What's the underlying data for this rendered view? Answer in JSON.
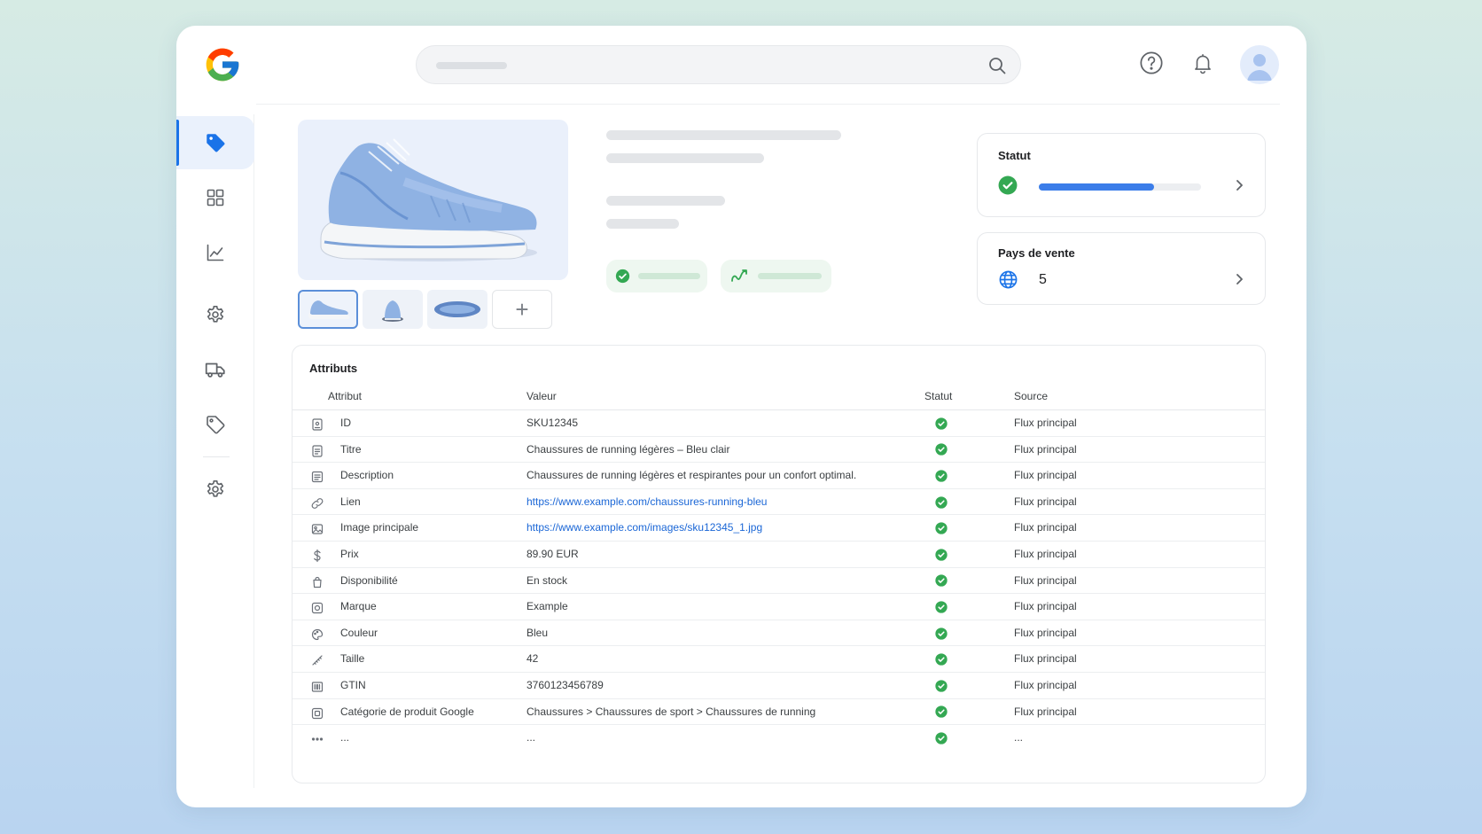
{
  "colors": {
    "accent": "#1a73e8",
    "success": "#34a853",
    "link": "#1a66d6"
  },
  "header": {
    "logo": "google-logo",
    "search": {
      "placeholder": ""
    },
    "icons": [
      "help-icon",
      "bell-icon",
      "account-icon"
    ]
  },
  "sidebar": {
    "items": [
      {
        "icon": "tag-icon",
        "active": true
      },
      {
        "icon": "grid-icon",
        "active": false
      },
      {
        "icon": "chart-icon",
        "active": false
      },
      {
        "icon": "gear-icon",
        "active": false
      },
      {
        "icon": "truck-icon",
        "active": false
      },
      {
        "icon": "tag-outline-icon",
        "active": false
      },
      {
        "icon": "gear-icon",
        "active": false
      }
    ]
  },
  "product": {
    "image": "running-shoe-light-blue",
    "thumbnails": [
      "shoe-side-view",
      "shoe-front-view",
      "shoe-sole-view"
    ],
    "add_label": "+"
  },
  "status_card": {
    "title": "Statut",
    "progress": 0.71,
    "icon": "check-circle-icon"
  },
  "countries_card": {
    "title": "Pays de vente",
    "count": "5",
    "icon": "globe-icon"
  },
  "attributes": {
    "title": "Attributs",
    "columns": {
      "attribute": "Attribut",
      "value": "Valeur",
      "status": "Statut",
      "source": "Source"
    },
    "rows": [
      {
        "icon": "id-icon",
        "attribute": "ID",
        "value": "SKU12345",
        "link": false,
        "status": "ok",
        "source": "Flux principal"
      },
      {
        "icon": "doc-icon",
        "attribute": "Titre",
        "value": "Chaussures de running légères – Bleu clair",
        "link": false,
        "status": "ok",
        "source": "Flux principal"
      },
      {
        "icon": "lines-icon",
        "attribute": "Description",
        "value": "Chaussures de running légères et respirantes pour un confort optimal.",
        "link": false,
        "status": "ok",
        "source": "Flux principal"
      },
      {
        "icon": "link-icon",
        "attribute": "Lien",
        "value": "https://www.example.com/chaussures-running-bleu",
        "link": true,
        "status": "ok",
        "source": "Flux principal"
      },
      {
        "icon": "image-icon",
        "attribute": "Image principale",
        "value": "https://www.example.com/images/sku12345_1.jpg",
        "link": true,
        "status": "ok",
        "source": "Flux principal"
      },
      {
        "icon": "dollar-icon",
        "attribute": "Prix",
        "value": "89.90 EUR",
        "link": false,
        "status": "ok",
        "source": "Flux principal"
      },
      {
        "icon": "bag-icon",
        "attribute": "Disponibilité",
        "value": "En stock",
        "link": false,
        "status": "ok",
        "source": "Flux principal"
      },
      {
        "icon": "brand-icon",
        "attribute": "Marque",
        "value": "Example",
        "link": false,
        "status": "ok",
        "source": "Flux principal"
      },
      {
        "icon": "palette-icon",
        "attribute": "Couleur",
        "value": "Bleu",
        "link": false,
        "status": "ok",
        "source": "Flux principal"
      },
      {
        "icon": "ruler-icon",
        "attribute": "Taille",
        "value": "42",
        "link": false,
        "status": "ok",
        "source": "Flux principal"
      },
      {
        "icon": "barcode-icon",
        "attribute": "GTIN",
        "value": "3760123456789",
        "link": false,
        "status": "ok",
        "source": "Flux principal"
      },
      {
        "icon": "category-icon",
        "attribute": "Catégorie de produit Google",
        "value": "Chaussures > Chaussures de sport > Chaussures de running",
        "link": false,
        "status": "ok",
        "source": "Flux principal"
      },
      {
        "icon": "more-icon",
        "attribute": "...",
        "value": "...",
        "link": false,
        "status": "ok",
        "source": "..."
      }
    ]
  }
}
